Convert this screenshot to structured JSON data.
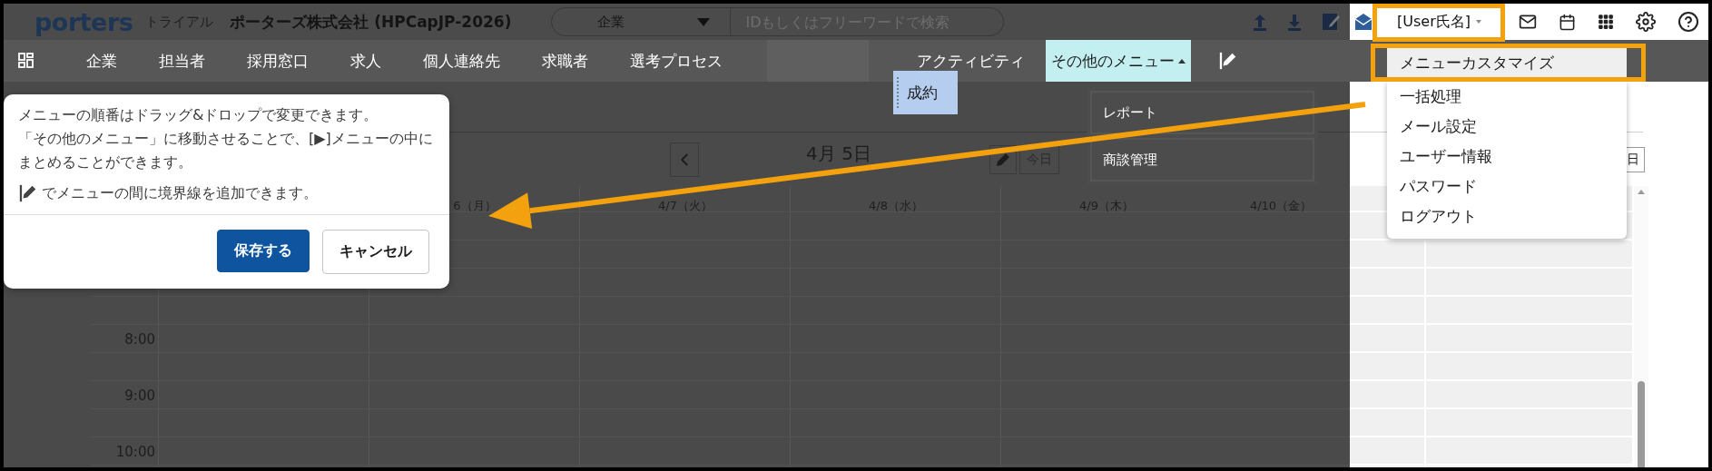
{
  "header": {
    "logo": "porters",
    "edition": "トライアル",
    "company": "ポーターズ株式会社 (HPCapJP-2026)",
    "search_scope": "企業",
    "search": {
      "placeholder": "IDもしくはフリーワードで検索"
    },
    "user_button": "[User氏名]"
  },
  "nav": {
    "items": [
      {
        "kind": "link",
        "label": "企業",
        "selected": false
      },
      {
        "kind": "link",
        "label": "担当者",
        "selected": false
      },
      {
        "kind": "link",
        "label": "採用窓口",
        "selected": false
      },
      {
        "kind": "link",
        "label": "求人",
        "selected": false
      },
      {
        "kind": "link",
        "label": "個人連絡先",
        "selected": false
      },
      {
        "kind": "link",
        "label": "求職者",
        "selected": false
      },
      {
        "kind": "link",
        "label": "選考プロセス",
        "selected": false
      },
      {
        "kind": "slot",
        "selected": false
      },
      {
        "kind": "link",
        "label": "アクティビティ",
        "selected": false
      },
      {
        "kind": "more",
        "label": "その他のメニュー",
        "selected": true,
        "expanded": true,
        "children": [
          {
            "label": "レポート"
          },
          {
            "label": "商談管理"
          }
        ]
      }
    ]
  },
  "dragged_item": {
    "label": "成約"
  },
  "user_menu": {
    "items": [
      {
        "label": "メニューカスタマイズ",
        "selected": true
      },
      {
        "label": "一括処理",
        "selected": false
      },
      {
        "label": "メール設定",
        "selected": false
      },
      {
        "label": "ユーザー情報",
        "selected": false
      },
      {
        "label": "パスワード",
        "selected": false
      },
      {
        "label": "ログアウト",
        "selected": false
      }
    ]
  },
  "calendar": {
    "title": "4月 5日",
    "today_button": "今日",
    "view_button": "日",
    "days": [
      "6（月）",
      "4/7（火）",
      "4/8（水）",
      "4/9（木）",
      "4/10（金）"
    ],
    "time_slots": [
      "8:00",
      "9:00",
      "10:00"
    ]
  },
  "popup": {
    "paragraphs": [
      "メニューの順番はドラッグ&ドロップで変更できます。",
      "「その他のメニュー」に移動させることで、[▶]メニューの中にまとめることができます。"
    ],
    "divider_hint": "でメニューの間に境界線を追加できます。",
    "buttons": [
      {
        "kind": "primary",
        "label": "保存する"
      },
      {
        "kind": "secondary",
        "label": "キャンセル"
      }
    ]
  }
}
